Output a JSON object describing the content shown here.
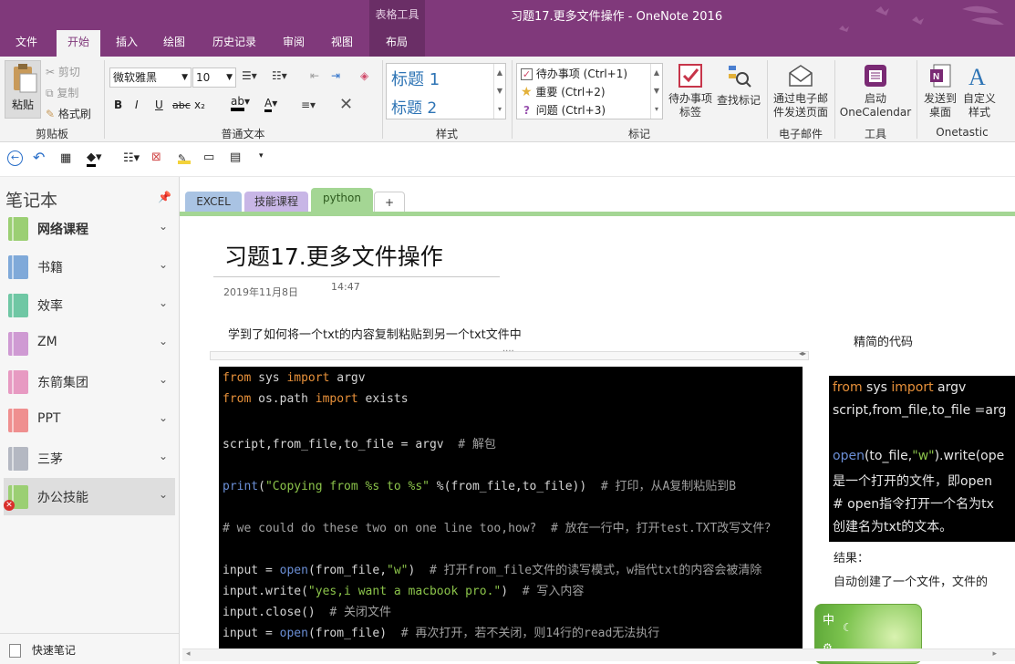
{
  "window": {
    "title": "习题17.更多文件操作 - OneNote 2016",
    "context_tab_group": "表格工具"
  },
  "ribbon_tabs": [
    "文件",
    "开始",
    "插入",
    "绘图",
    "历史记录",
    "审阅",
    "视图",
    "布局"
  ],
  "clipboard": {
    "paste": "粘贴",
    "cut": "剪切",
    "copy": "复制",
    "format_painter": "格式刷",
    "group": "剪贴板"
  },
  "text_format": {
    "font": "微软雅黑",
    "size": "10",
    "bold": "B",
    "italic": "I",
    "underline": "U",
    "strike": "abc",
    "subscript": "x₂",
    "font_color": "A",
    "group": "普通文本"
  },
  "styles": {
    "items": [
      "标题 1",
      "标题 2"
    ],
    "group": "样式"
  },
  "tags": {
    "items": [
      "待办事项 (Ctrl+1)",
      "重要 (Ctrl+2)",
      "问题 (Ctrl+3)"
    ],
    "todo_tag": "待办事项\n标签",
    "find_tags": "查找标记",
    "group": "标记"
  },
  "email": {
    "label": "通过电子邮\n件发送页面",
    "group": "电子邮件"
  },
  "tools": {
    "label": "启动\nOneCalendar",
    "group": "工具"
  },
  "onetastic": {
    "send": "发送到\n桌面",
    "custom": "自定义\n样式",
    "group": "Onetastic"
  },
  "sidebar": {
    "title": "笔记本",
    "notebooks": [
      {
        "name": "网络课程",
        "color": "#9bcf73"
      },
      {
        "name": "书籍",
        "color": "#7fa9d9"
      },
      {
        "name": "效率",
        "color": "#6fc7a4"
      },
      {
        "name": "ZM",
        "color": "#cf9ad3"
      },
      {
        "name": "东箭集团",
        "color": "#e79ac2"
      },
      {
        "name": "PPT",
        "color": "#ef8f8f"
      },
      {
        "name": "三茅",
        "color": "#b4b8c2"
      },
      {
        "name": "办公技能",
        "color": "#9bcf73"
      }
    ],
    "quick_notes": "快速笔记"
  },
  "sections": [
    {
      "name": "EXCEL",
      "color": "#a9c3e3"
    },
    {
      "name": "技能课程",
      "color": "#c8b6e6"
    },
    {
      "name": "python",
      "color": "#a4d694"
    },
    {
      "name": "+",
      "color": "#ffffff"
    }
  ],
  "page": {
    "title": "习题17.更多文件操作",
    "date": "2019年11月8日",
    "time": "14:47",
    "intro": "学到了如何将一个txt的内容复制粘贴到另一个txt文件中",
    "side_heading": "精简的代码",
    "result_label": "结果：",
    "result_text": "自动创建了一个文件，文件的"
  },
  "code_main": [
    [
      [
        "kw",
        "from"
      ],
      [
        "t",
        " sys "
      ],
      [
        "kw",
        "import"
      ],
      [
        "t",
        " argv"
      ]
    ],
    [
      [
        "kw",
        "from"
      ],
      [
        "t",
        " os.path "
      ],
      [
        "kw",
        "import"
      ],
      [
        "t",
        " exists"
      ]
    ],
    [],
    [
      [
        "t",
        "script,from_file,to_file = argv  "
      ],
      [
        "cm",
        "# 解包"
      ]
    ],
    [],
    [
      [
        "fn",
        "print"
      ],
      [
        "t",
        "("
      ],
      [
        "st",
        "\"Copying from %s to %s\""
      ],
      [
        "t",
        " %(from_file,to_file))  "
      ],
      [
        "cm",
        "# 打印，从A复制粘贴到B"
      ]
    ],
    [],
    [
      [
        "cm",
        "# we could do these two on one line too,how?  # 放在一行中，打开test.TXT改写文件？"
      ]
    ],
    [],
    [
      [
        "t",
        "input = "
      ],
      [
        "fn",
        "open"
      ],
      [
        "t",
        "(from_file,"
      ],
      [
        "st",
        "\"w\""
      ],
      [
        "t",
        ")  "
      ],
      [
        "cm",
        "# 打开from_file文件的读写模式，w指代txt的内容会被清除"
      ]
    ],
    [
      [
        "t",
        "input.write("
      ],
      [
        "st",
        "\"yes,i want a macbook pro.\""
      ],
      [
        "t",
        ")  "
      ],
      [
        "cm",
        "# 写入内容"
      ]
    ],
    [
      [
        "t",
        "input.close()  "
      ],
      [
        "cm",
        "# 关闭文件"
      ]
    ],
    [
      [
        "t",
        "input = "
      ],
      [
        "fn",
        "open"
      ],
      [
        "t",
        "(from_file)  "
      ],
      [
        "cm",
        "# 再次打开，若不关闭，则14行的read无法执行"
      ]
    ]
  ],
  "code_side": [
    [
      [
        "kw",
        "from"
      ],
      [
        "t",
        " sys "
      ],
      [
        "kw",
        "import"
      ],
      [
        "t",
        " argv"
      ]
    ],
    [
      [
        "t",
        "script,from_file,to_file =arg"
      ]
    ],
    [],
    [
      [
        "fn",
        "open"
      ],
      [
        "t",
        "(to_file,"
      ],
      [
        "st",
        "\"w\""
      ],
      [
        "t",
        ").write(ope"
      ]
    ],
    [
      [
        "t",
        "是一个打开的文件，即open"
      ]
    ],
    [
      [
        "t",
        "# open指令打开一个名为tx"
      ]
    ],
    [
      [
        "t",
        "创建名为txt的文本。"
      ]
    ]
  ],
  "widget": {
    "ime": "中"
  }
}
